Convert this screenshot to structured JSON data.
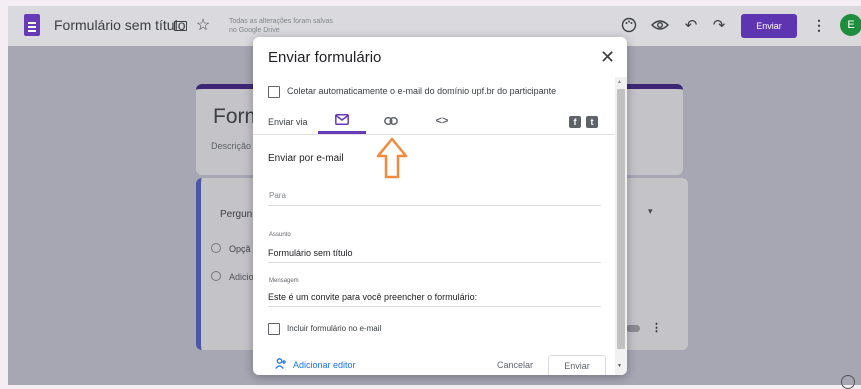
{
  "app": {
    "title": "Formulário sem título",
    "save_status": "Todas as alterações foram salvas no Google Drive",
    "send_button": "Enviar",
    "avatar_letter": "E",
    "accent": "#5e35b1"
  },
  "background_form": {
    "title": "Form",
    "description": "Descrição",
    "question": "Pergun",
    "option_1": "Opçã",
    "option_2": "Adicio"
  },
  "dialog": {
    "title": "Enviar formulário",
    "collect_email_label": "Coletar automaticamente o e-mail do domínio upf.br do participante",
    "send_via_label": "Enviar via",
    "tabs": [
      {
        "icon": "email-icon",
        "active": true
      },
      {
        "icon": "link-icon",
        "active": false
      },
      {
        "icon": "embed-icon",
        "active": false
      }
    ],
    "embed_tab_glyph": "<>",
    "facebook_glyph": "f",
    "twitter_glyph": "t",
    "section_title": "Enviar por e-mail",
    "to_placeholder": "Para",
    "subject_label": "Assunto",
    "subject_value": "Formulário sem título",
    "message_label": "Mensagem",
    "message_value": "Este é um convite para você preencher o formulário:",
    "include_form_label": "Incluir formulário no e-mail",
    "add_editor_label": "Adicionar editor",
    "cancel_label": "Cancelar",
    "send_label": "Enviar"
  },
  "annotation": {
    "arrow_color": "#f08a3c"
  }
}
